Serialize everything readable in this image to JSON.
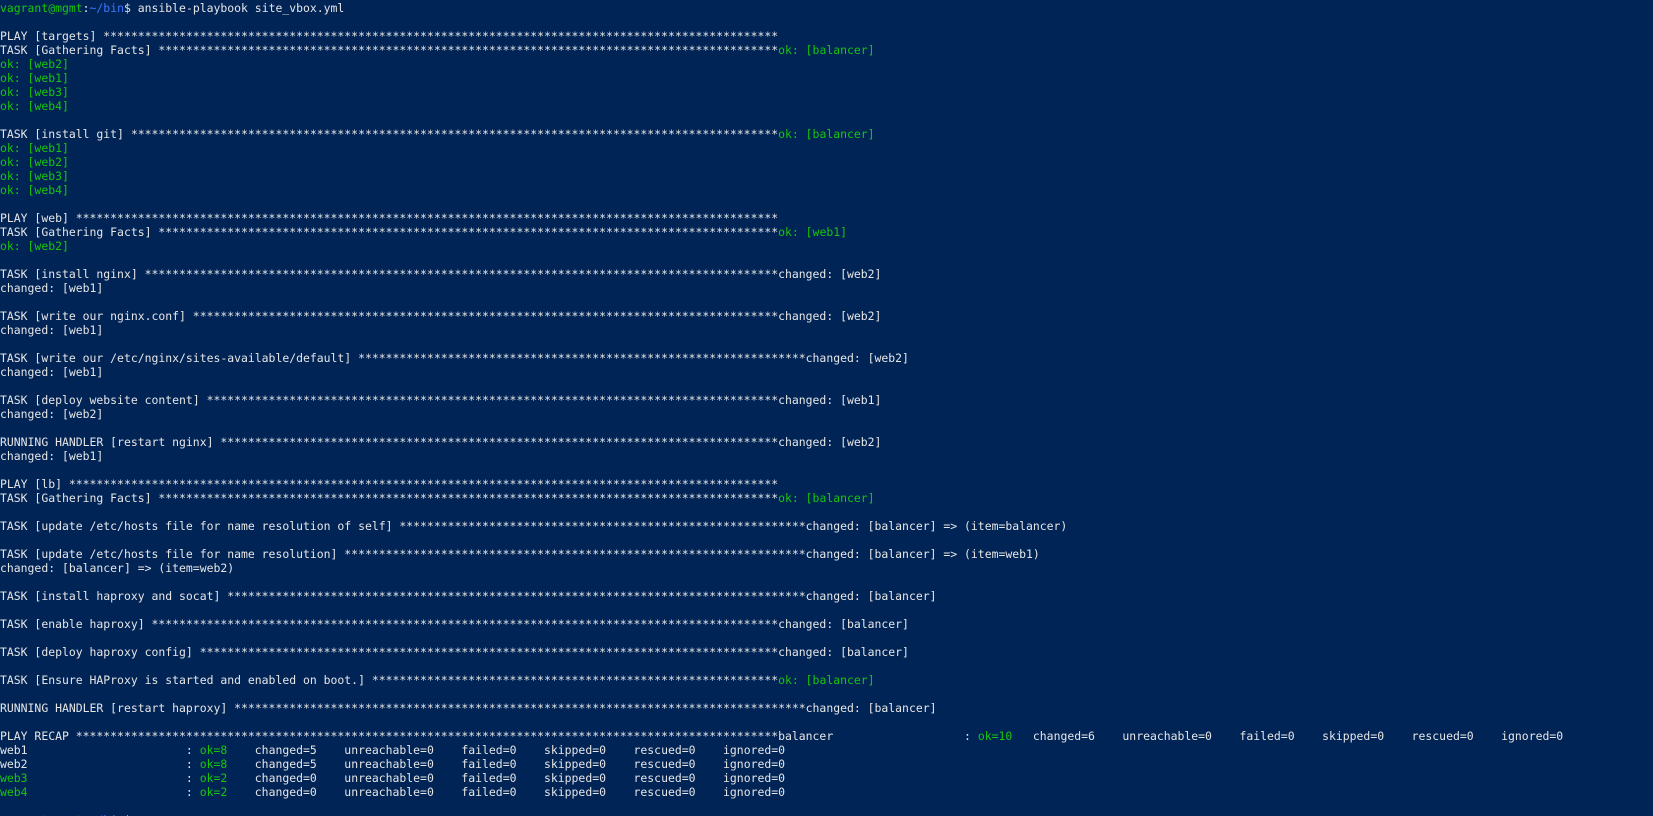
{
  "colors": {
    "background": "#012456",
    "text": "#e6e6e6",
    "ok": "#16c60c",
    "user_prompt": "#16c60c",
    "path_blue": "#3b78ff"
  },
  "lines": [
    [
      [
        "g",
        "vagrant@mgmt"
      ],
      [
        "w",
        ":"
      ],
      [
        "b",
        "~/bin"
      ],
      [
        "w",
        "$ ansible-playbook site_vbox.yml"
      ]
    ],
    [],
    [
      [
        "w",
        "PLAY [targets] **************************************************************************************************"
      ]
    ],
    [
      [
        "w",
        "TASK [Gathering Facts] ******************************************************************************************"
      ],
      [
        "g",
        "ok: [balancer]"
      ]
    ],
    [
      [
        "g",
        "ok: [web2]"
      ]
    ],
    [
      [
        "g",
        "ok: [web1]"
      ]
    ],
    [
      [
        "g",
        "ok: [web3]"
      ]
    ],
    [
      [
        "g",
        "ok: [web4]"
      ]
    ],
    [],
    [
      [
        "w",
        "TASK [install git] **********************************************************************************************"
      ],
      [
        "g",
        "ok: [balancer]"
      ]
    ],
    [
      [
        "g",
        "ok: [web1]"
      ]
    ],
    [
      [
        "g",
        "ok: [web2]"
      ]
    ],
    [
      [
        "g",
        "ok: [web3]"
      ]
    ],
    [
      [
        "g",
        "ok: [web4]"
      ]
    ],
    [],
    [
      [
        "w",
        "PLAY [web] ******************************************************************************************************"
      ]
    ],
    [
      [
        "w",
        "TASK [Gathering Facts] ******************************************************************************************"
      ],
      [
        "g",
        "ok: [web1]"
      ]
    ],
    [
      [
        "g",
        "ok: [web2]"
      ]
    ],
    [],
    [
      [
        "w",
        "TASK [install nginx] ********************************************************************************************changed: [web2]"
      ]
    ],
    [
      [
        "w",
        "changed: [web1]"
      ]
    ],
    [],
    [
      [
        "w",
        "TASK [write our nginx.conf] *************************************************************************************changed: [web2]"
      ]
    ],
    [
      [
        "w",
        "changed: [web1]"
      ]
    ],
    [],
    [
      [
        "w",
        "TASK [write our /etc/nginx/sites-available/default] *****************************************************************changed: [web2]"
      ]
    ],
    [
      [
        "w",
        "changed: [web1]"
      ]
    ],
    [],
    [
      [
        "w",
        "TASK [deploy website content] ***********************************************************************************changed: [web1]"
      ]
    ],
    [
      [
        "w",
        "changed: [web2]"
      ]
    ],
    [],
    [
      [
        "w",
        "RUNNING HANDLER [restart nginx] *********************************************************************************changed: [web2]"
      ]
    ],
    [
      [
        "w",
        "changed: [web1]"
      ]
    ],
    [],
    [
      [
        "w",
        "PLAY [lb] *******************************************************************************************************"
      ]
    ],
    [
      [
        "w",
        "TASK [Gathering Facts] ******************************************************************************************"
      ],
      [
        "g",
        "ok: [balancer]"
      ]
    ],
    [],
    [
      [
        "w",
        "TASK [update /etc/hosts file for name resolution of self] ***********************************************************changed: [balancer] => (item=balancer)"
      ]
    ],
    [],
    [
      [
        "w",
        "TASK [update /etc/hosts file for name resolution] *******************************************************************changed: [balancer] => (item=web1)"
      ]
    ],
    [
      [
        "w",
        "changed: [balancer] => (item=web2)"
      ]
    ],
    [],
    [
      [
        "w",
        "TASK [install haproxy and socat] ************************************************************************************changed: [balancer]"
      ]
    ],
    [],
    [
      [
        "w",
        "TASK [enable haproxy] *******************************************************************************************changed: [balancer]"
      ]
    ],
    [],
    [
      [
        "w",
        "TASK [deploy haproxy config] ************************************************************************************changed: [balancer]"
      ]
    ],
    [],
    [
      [
        "w",
        "TASK [Ensure HAProxy is started and enabled on boot.] ***********************************************************"
      ],
      [
        "g",
        "ok: [balancer]"
      ]
    ],
    [],
    [
      [
        "w",
        "RUNNING HANDLER [restart haproxy] ***********************************************************************************changed: [balancer]"
      ]
    ],
    [],
    [
      [
        "w",
        "PLAY RECAP ******************************************************************************************************balancer                   : "
      ],
      [
        "g",
        "ok=10"
      ],
      [
        "w",
        "   changed=6    unreachable=0    failed=0    skipped=0    rescued=0    ignored=0"
      ]
    ],
    [
      [
        "w",
        "web1                       : "
      ],
      [
        "g",
        "ok=8"
      ],
      [
        "w",
        "    changed=5    unreachable=0    failed=0    skipped=0    rescued=0    ignored=0"
      ]
    ],
    [
      [
        "w",
        "web2                       : "
      ],
      [
        "g",
        "ok=8"
      ],
      [
        "w",
        "    changed=5    unreachable=0    failed=0    skipped=0    rescued=0    ignored=0"
      ]
    ],
    [
      [
        "g",
        "web3"
      ],
      [
        "w",
        "                       : "
      ],
      [
        "g",
        "ok=2"
      ],
      [
        "w",
        "    changed=0    unreachable=0    failed=0    skipped=0    rescued=0    ignored=0"
      ]
    ],
    [
      [
        "g",
        "web4"
      ],
      [
        "w",
        "                       : "
      ],
      [
        "g",
        "ok=2"
      ],
      [
        "w",
        "    changed=0    unreachable=0    failed=0    skipped=0    rescued=0    ignored=0"
      ]
    ],
    [],
    [
      [
        "g",
        "vagrant@mgmt"
      ],
      [
        "w",
        ":"
      ],
      [
        "b",
        "~/bin"
      ],
      [
        "w",
        "$ "
      ]
    ]
  ]
}
